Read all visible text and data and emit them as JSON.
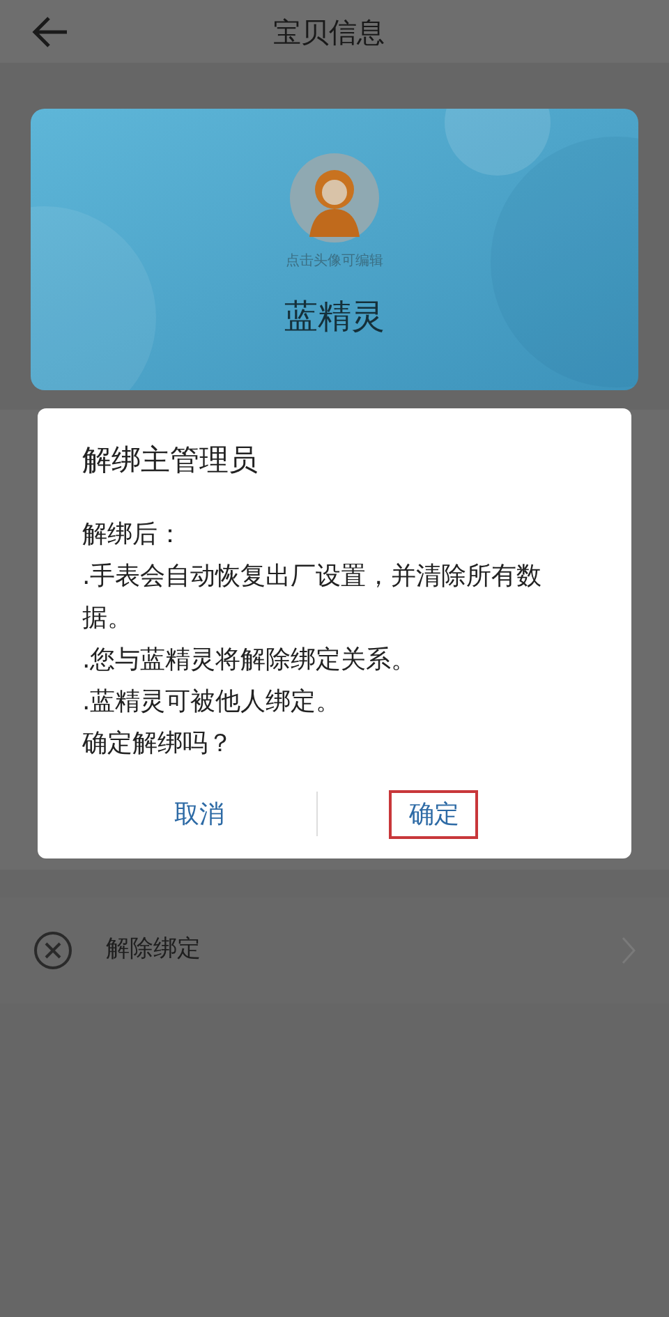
{
  "header": {
    "title": "宝贝信息"
  },
  "profile": {
    "avatar_hint": "点击头像可编辑",
    "name": "蓝精灵"
  },
  "menu": [
    {
      "label": "解除绑定"
    }
  ],
  "dialog": {
    "title": "解绑主管理员",
    "lines": [
      "解绑后：",
      ".手表会自动恢复出厂设置，并清除所有数据。",
      ".您与蓝精灵将解除绑定关系。",
      ".蓝精灵可被他人绑定。",
      "确定解绑吗？"
    ],
    "buttons": [
      {
        "label": "取消",
        "highlighted": false
      },
      {
        "label": "确定",
        "highlighted": true
      }
    ]
  }
}
